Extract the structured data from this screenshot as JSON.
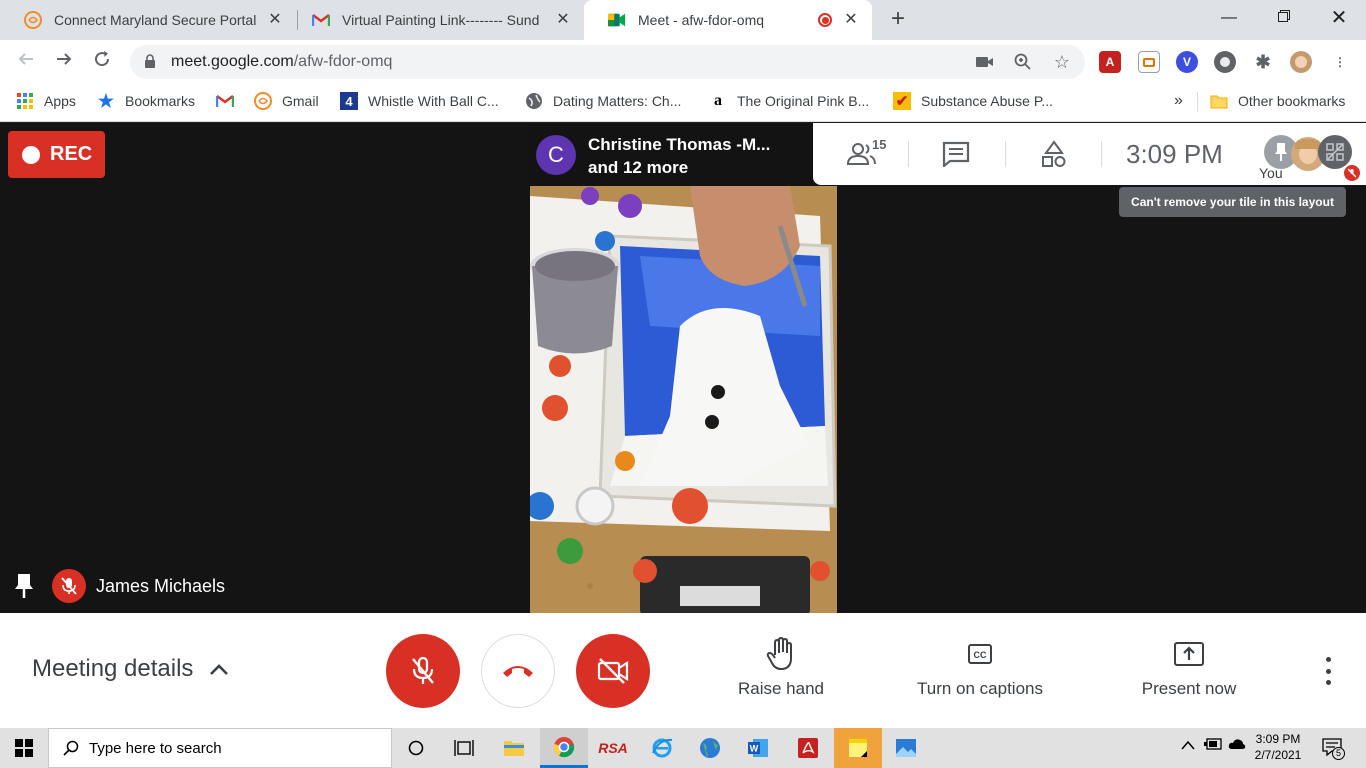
{
  "browser": {
    "tabs": [
      {
        "title": "Connect Maryland Secure Portal",
        "active": false
      },
      {
        "title": "Virtual Painting Link-------- Sund",
        "active": false
      },
      {
        "title": "Meet - afw-fdor-omq",
        "active": true
      }
    ],
    "url_host": "meet.google.com",
    "url_path": "/afw-fdor-omq",
    "bookmarks": [
      {
        "label": "Apps",
        "icon": "apps-grid-icon"
      },
      {
        "label": "Bookmarks",
        "icon": "star-icon"
      },
      {
        "label": "",
        "icon": "gmail-icon"
      },
      {
        "label": "Gmail",
        "icon": "portal-icon"
      },
      {
        "label": "Whistle With Ball C...",
        "icon": "whistle-icon"
      },
      {
        "label": "Dating Matters: Ch...",
        "icon": "globe-icon"
      },
      {
        "label": "The Original Pink B...",
        "icon": "amazon-icon"
      },
      {
        "label": "Substance Abuse P...",
        "icon": "checkbox-icon"
      }
    ],
    "overflow_label": "»",
    "other_bookmarks": "Other bookmarks"
  },
  "meet": {
    "rec_label": "REC",
    "presenter_initial": "C",
    "presenter_name": "Christine Thomas -M...",
    "presenter_more": "and 12 more",
    "participants_count": "15",
    "time": "3:09  PM",
    "self_label": "You",
    "tooltip": "Can't remove your tile in this layout",
    "pinned_name": "James Michaels",
    "meeting_details": "Meeting details",
    "raise_hand": "Raise hand",
    "captions": "Turn on captions",
    "present": "Present now"
  },
  "taskbar": {
    "search_placeholder": "Type here to search",
    "rsa_label": "RSA",
    "clock_time": "3:09 PM",
    "clock_date": "2/7/2021",
    "notif_count": "5"
  },
  "colors": {
    "meet_red": "#d93025",
    "presenter_avatar": "#5e35b1",
    "chrome_tabstrip": "#dee1e6"
  }
}
